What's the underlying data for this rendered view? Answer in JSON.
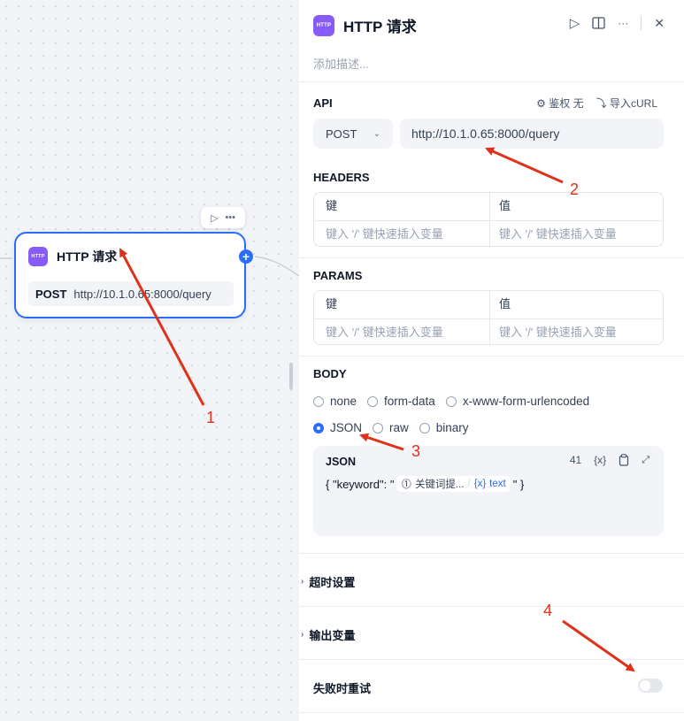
{
  "canvas": {
    "node": {
      "badge": "HTTP",
      "title": "HTTP 请求",
      "method": "POST",
      "url": "http://10.1.0.65:8000/query"
    }
  },
  "panel": {
    "badge": "HTTP",
    "title": "HTTP 请求",
    "description_placeholder": "添加描述...",
    "api": {
      "label": "API",
      "auth_label": "鉴权 无",
      "import_label": "导入cURL",
      "method": "POST",
      "url": "http://10.1.0.65:8000/query"
    },
    "headers": {
      "label": "HEADERS",
      "key_col": "键",
      "value_col": "值",
      "key_placeholder": "键入 '/' 键快速插入变量",
      "value_placeholder": "键入 '/' 键快速插入变量"
    },
    "params": {
      "label": "PARAMS",
      "key_col": "键",
      "value_col": "值",
      "key_placeholder": "键入 '/' 键快速插入变量",
      "value_placeholder": "键入 '/' 键快速插入变量"
    },
    "body": {
      "label": "BODY",
      "options": [
        {
          "label": "none",
          "selected": false
        },
        {
          "label": "form-data",
          "selected": false
        },
        {
          "label": "x-www-form-urlencoded",
          "selected": false
        },
        {
          "label": "JSON",
          "selected": true
        },
        {
          "label": "raw",
          "selected": false
        },
        {
          "label": "binary",
          "selected": false
        }
      ],
      "json": {
        "label": "JSON",
        "count": "41",
        "var_button": "{x}",
        "content_prefix": "{ \"keyword\": \"",
        "var_node": "关键词提...",
        "var_name": "text",
        "content_suffix": "\" }"
      }
    },
    "timeout_label": "超时设置",
    "output_label": "输出变量",
    "retry_label": "失败时重试"
  },
  "annotations": [
    "1",
    "2",
    "3",
    "4"
  ],
  "colors": {
    "accent": "#296dff",
    "badge": "#875bf7",
    "annotation": "#e0321b"
  }
}
